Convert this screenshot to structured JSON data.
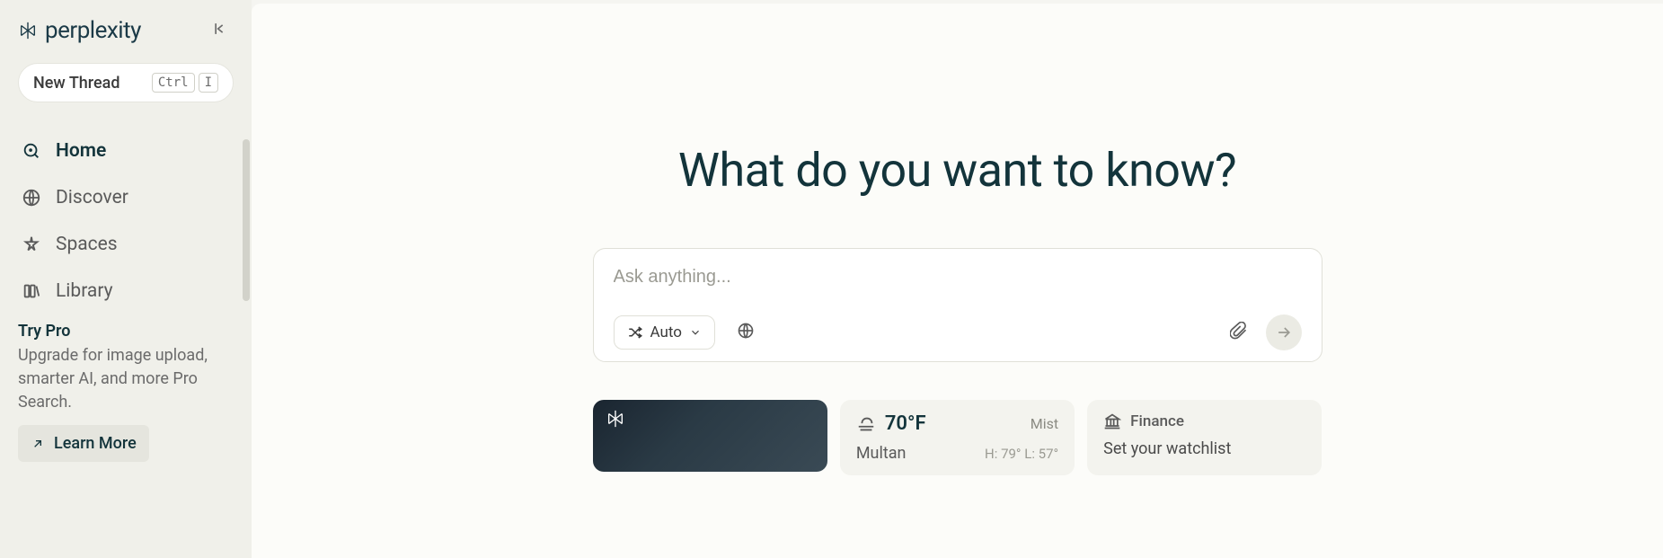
{
  "brand": "perplexity",
  "sidebar": {
    "new_thread_label": "New Thread",
    "kbd1": "Ctrl",
    "kbd2": "I",
    "nav": [
      {
        "label": "Home"
      },
      {
        "label": "Discover"
      },
      {
        "label": "Spaces"
      },
      {
        "label": "Library"
      }
    ],
    "pro": {
      "title": "Try Pro",
      "desc": "Upgrade for image upload, smarter AI, and more Pro Search.",
      "learn_more": "Learn More"
    }
  },
  "main": {
    "hero": "What do you want to know?",
    "search": {
      "placeholder": "Ask anything...",
      "mode_label": "Auto"
    },
    "weather": {
      "temp": "70°F",
      "cond": "Mist",
      "city": "Multan",
      "hl": "H: 79° L: 57°"
    },
    "finance": {
      "title": "Finance",
      "sub": "Set your watchlist"
    }
  }
}
